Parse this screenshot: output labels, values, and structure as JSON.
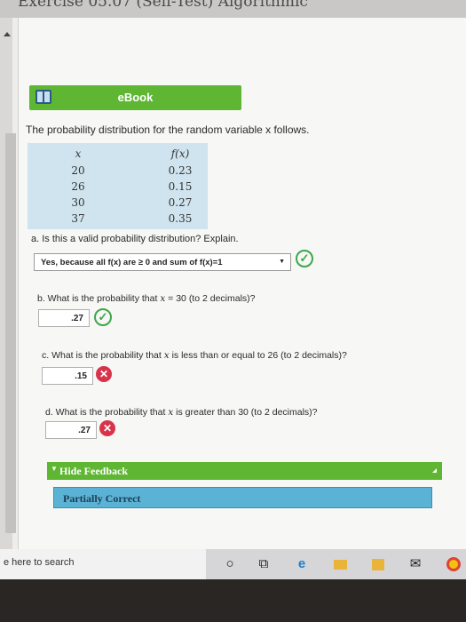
{
  "header": {
    "title": "Exercise 05.07 (Self-Test) Algorithmic"
  },
  "ebook": {
    "label": "eBook"
  },
  "problem": {
    "intro": "The probability distribution for the random variable x follows.",
    "table": {
      "col_x": "x",
      "col_f": "f(x)",
      "x_values": [
        "20",
        "26",
        "30",
        "37"
      ],
      "f_values": [
        "0.23",
        "0.15",
        "0.27",
        "0.35"
      ]
    }
  },
  "qa": {
    "question": "a. Is this a valid probability distribution? Explain.",
    "answer": "Yes, because all f(x) are ≥ 0 and sum of f(x)=1",
    "status": "correct"
  },
  "qb": {
    "pre": "b. What is the probability that ",
    "var": "x",
    "post": " = 30 (to 2 decimals)?",
    "answer": ".27",
    "status": "correct"
  },
  "qc": {
    "pre": "c. What is the probability that ",
    "var": "x",
    "post": " is less than or equal to 26 (to 2 decimals)?",
    "answer": ".15",
    "status": "incorrect"
  },
  "qd": {
    "pre": "d. What is the probability that ",
    "var": "x",
    "post": " is greater than 30 (to 2 decimals)?",
    "answer": ".27",
    "status": "incorrect"
  },
  "feedback": {
    "toggle_label": "Hide Feedback",
    "result": "Partially Correct"
  },
  "taskbar": {
    "search_placeholder": "e here to search"
  },
  "colors": {
    "accent_green": "#5fb632",
    "correct": "#3ca84a",
    "incorrect": "#d9334b",
    "feedback_blue": "#5ab2d4"
  }
}
